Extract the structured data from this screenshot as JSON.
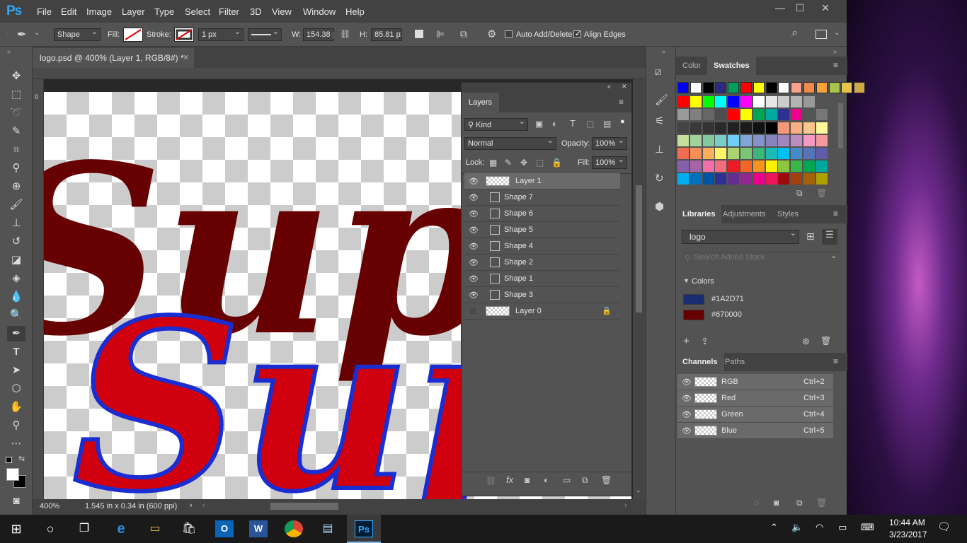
{
  "app": {
    "logo": "Ps",
    "menu": [
      "File",
      "Edit",
      "Image",
      "Layer",
      "Type",
      "Select",
      "Filter",
      "3D",
      "View",
      "Window",
      "Help"
    ],
    "window_controls": {
      "minimize": "—",
      "maximize": "☐",
      "close": "✕"
    }
  },
  "options": {
    "mode": "Shape",
    "fill_label": "Fill:",
    "stroke_label": "Stroke:",
    "stroke_width": "1 px",
    "w_label": "W:",
    "w_value": "154.38 p",
    "h_label": "H:",
    "h_value": "85.81 px",
    "auto_add_delete": "Auto Add/Delete",
    "align_edges": "Align Edges"
  },
  "document": {
    "tab_title": "logo.psd @ 400% (Layer 1, RGB/8#) *",
    "ruler_zero": "0",
    "zoom": "400%",
    "doc_info": "1.545 in x 0.34 in (600 ppi)"
  },
  "layers_panel": {
    "tab": "Layers",
    "kind": "Kind",
    "blend_mode": "Normal",
    "opacity_label": "Opacity:",
    "opacity": "100%",
    "lock_label": "Lock:",
    "fill_label": "Fill:",
    "fill": "100%",
    "layers": [
      {
        "name": "Layer 1",
        "visible": true,
        "selected": true,
        "kind": "pixel"
      },
      {
        "name": "Shape 7",
        "visible": true,
        "selected": false,
        "kind": "shape"
      },
      {
        "name": "Shape 6",
        "visible": true,
        "selected": false,
        "kind": "shape"
      },
      {
        "name": "Shape 5",
        "visible": true,
        "selected": false,
        "kind": "shape"
      },
      {
        "name": "Shape 4",
        "visible": true,
        "selected": false,
        "kind": "shape"
      },
      {
        "name": "Shape 2",
        "visible": true,
        "selected": false,
        "kind": "shape"
      },
      {
        "name": "Shape 1",
        "visible": true,
        "selected": false,
        "kind": "shape"
      },
      {
        "name": "Shape 3",
        "visible": true,
        "selected": false,
        "kind": "shape"
      },
      {
        "name": "Layer 0",
        "visible": false,
        "selected": false,
        "kind": "pixel",
        "locked": true
      }
    ]
  },
  "color_panel": {
    "tabs": [
      "Color",
      "Swatches"
    ],
    "swatches": [
      [
        "#0000ff",
        "#ffffff",
        "#000000",
        "#2b2b7d",
        "#00a05a",
        "#ff0000",
        "#ffff00",
        "#000000",
        "#ffffff",
        "#f7a08a",
        "#f08a4b",
        "#f9a13a",
        "#a5c64a",
        "#e7c34a",
        "#cfa84a"
      ],
      [
        "#ff0000",
        "#ffff00",
        "#00ff00",
        "#00ffff",
        "#0000ff",
        "#ff00ff",
        "#ffffff",
        "#e6e6e6",
        "#cccccc",
        "#b3b3b3",
        "#999999"
      ],
      [
        "#999999",
        "#808080",
        "#666666",
        "#4d4d4d",
        "#ff0000",
        "#ffff00",
        "#00a651",
        "#00a99d",
        "#2e3192",
        "#ec008c",
        "#555555",
        "#777777"
      ],
      [
        "#444444",
        "#3a3a3a",
        "#333333",
        "#2a2a2a",
        "#222222",
        "#1a1a1a",
        "#111111",
        "#000000",
        "#f7977a",
        "#f9ad81",
        "#fdc68a",
        "#fff79a"
      ],
      [
        "#c4df9b",
        "#a3d39c",
        "#82ca9d",
        "#7bcdc8",
        "#6ecff6",
        "#7ea7d8",
        "#8493ca",
        "#8882be",
        "#a187be",
        "#bc8dbf",
        "#f49ac2",
        "#f6989d"
      ],
      [
        "#f26c4f",
        "#f68e55",
        "#fbaf5c",
        "#fff467",
        "#acd372",
        "#7cc576",
        "#3bb878",
        "#1abbb4",
        "#00bff3",
        "#438ccb",
        "#5574b9",
        "#605ca8"
      ],
      [
        "#855fa8",
        "#a763a8",
        "#f06ea9",
        "#f26d7d",
        "#ed1c24",
        "#f26522",
        "#f7941d",
        "#fff200",
        "#8dc73f",
        "#39b54a",
        "#00a651",
        "#00a99d"
      ],
      [
        "#00aeef",
        "#0072bc",
        "#0054a6",
        "#2e3192",
        "#662d91",
        "#92278f",
        "#ec008c",
        "#ed145b",
        "#9e0b0f",
        "#a0410d",
        "#a36209",
        "#aba000"
      ]
    ]
  },
  "libraries_panel": {
    "tabs": [
      "Libraries",
      "Adjustments",
      "Styles"
    ],
    "library": "logo",
    "search_placeholder": "Search Adobe Stock",
    "colors_label": "Colors",
    "colors": [
      {
        "hex": "#1A2D71",
        "label": "#1A2D71"
      },
      {
        "hex": "#670000",
        "label": "#670000"
      }
    ]
  },
  "channels_panel": {
    "tabs": [
      "Channels",
      "Paths"
    ],
    "channels": [
      {
        "name": "RGB",
        "shortcut": "Ctrl+2"
      },
      {
        "name": "Red",
        "shortcut": "Ctrl+3"
      },
      {
        "name": "Green",
        "shortcut": "Ctrl+4"
      },
      {
        "name": "Blue",
        "shortcut": "Ctrl+5"
      }
    ]
  },
  "canvas_art": {
    "text_back": "Sup",
    "text_front": "Sup",
    "dark_fill": "#670000",
    "red_fill": "#d0000f",
    "outline": "#1a2dd1"
  },
  "taskbar": {
    "time": "10:44 AM",
    "date": "3/23/2017"
  }
}
